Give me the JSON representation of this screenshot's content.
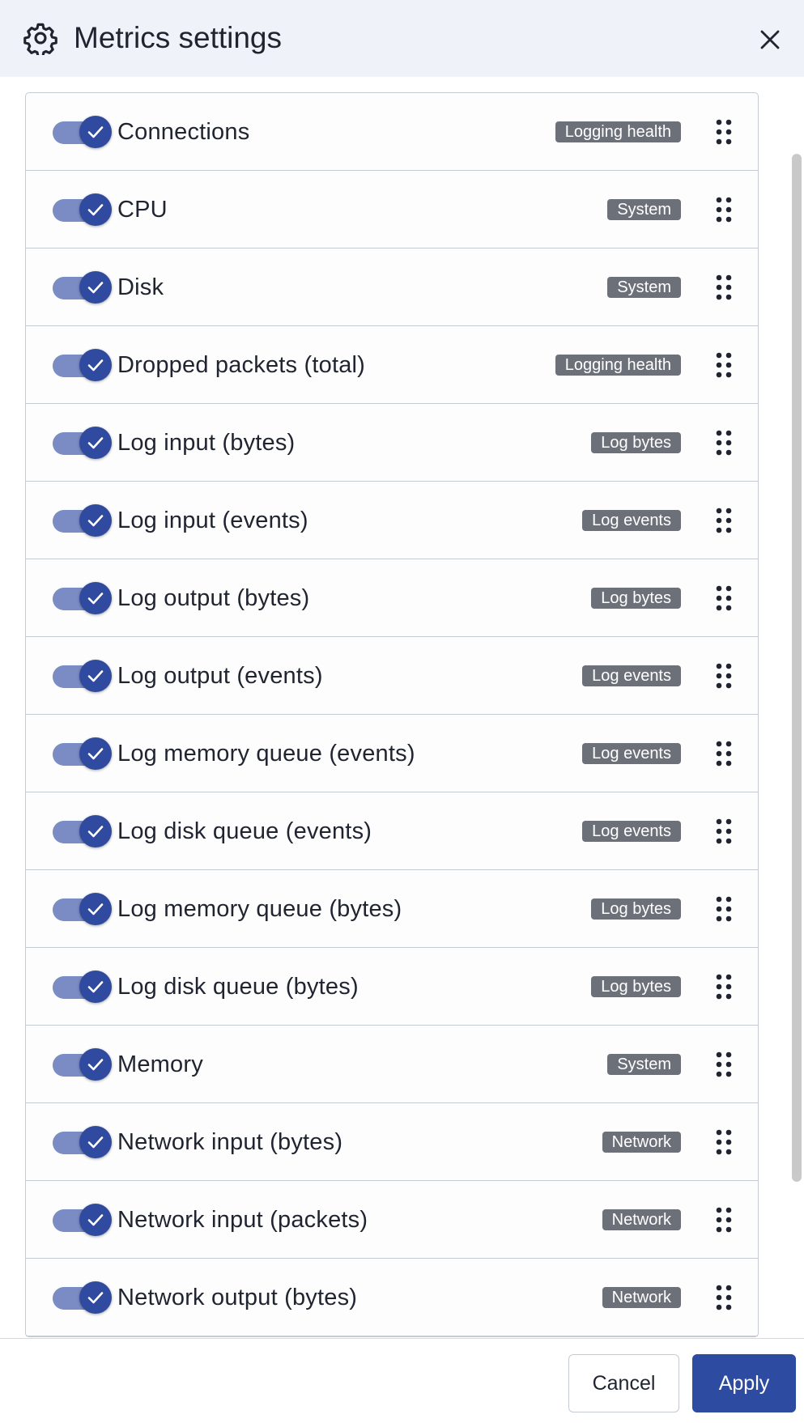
{
  "header": {
    "title": "Metrics settings"
  },
  "metrics": [
    {
      "label": "Connections",
      "badge": "Logging health",
      "enabled": true
    },
    {
      "label": "CPU",
      "badge": "System",
      "enabled": true
    },
    {
      "label": "Disk",
      "badge": "System",
      "enabled": true
    },
    {
      "label": "Dropped packets (total)",
      "badge": "Logging health",
      "enabled": true
    },
    {
      "label": "Log input (bytes)",
      "badge": "Log bytes",
      "enabled": true
    },
    {
      "label": "Log input (events)",
      "badge": "Log events",
      "enabled": true
    },
    {
      "label": "Log output (bytes)",
      "badge": "Log bytes",
      "enabled": true
    },
    {
      "label": "Log output (events)",
      "badge": "Log events",
      "enabled": true
    },
    {
      "label": "Log memory queue (events)",
      "badge": "Log events",
      "enabled": true
    },
    {
      "label": "Log disk queue (events)",
      "badge": "Log events",
      "enabled": true
    },
    {
      "label": "Log memory queue (bytes)",
      "badge": "Log bytes",
      "enabled": true
    },
    {
      "label": "Log disk queue (bytes)",
      "badge": "Log bytes",
      "enabled": true
    },
    {
      "label": "Memory",
      "badge": "System",
      "enabled": true
    },
    {
      "label": "Network input (bytes)",
      "badge": "Network",
      "enabled": true
    },
    {
      "label": "Network input (packets)",
      "badge": "Network",
      "enabled": true
    },
    {
      "label": "Network output (bytes)",
      "badge": "Network",
      "enabled": true
    }
  ],
  "footer": {
    "cancel_label": "Cancel",
    "apply_label": "Apply"
  },
  "colors": {
    "accent": "#2d4ba0",
    "badge": "#6b7079",
    "header_bg": "#eff3f9",
    "toggle_track": "#7b8cc4"
  }
}
